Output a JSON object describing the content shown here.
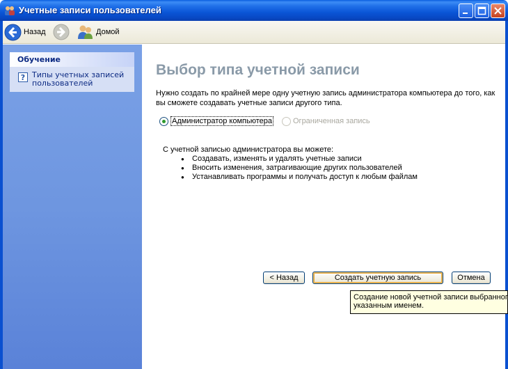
{
  "window": {
    "title": "Учетные записи пользователей"
  },
  "toolbar": {
    "back_label": "Назад",
    "home_label": "Домой"
  },
  "sidebar": {
    "header": "Обучение",
    "link": "Типы учетных записей пользователей"
  },
  "main": {
    "title": "Выбор типа учетной записи",
    "description": "Нужно создать по крайней мере одну учетную запись администратора компьютера до того, как вы сможете создавать учетные записи другого типа.",
    "radio_admin": "Администратор компьютера",
    "radio_limited": "Ограниченная запись",
    "info_heading": "С учетной записью администратора вы можете:",
    "bullets": [
      "Создавать, изменять и удалять учетные записи",
      "Вносить изменения, затрагивающие других пользователей",
      "Устанавливать программы и получать доступ к любым файлам"
    ]
  },
  "buttons": {
    "back": "< Назад",
    "create": "Создать учетную запись",
    "cancel": "Отмена"
  },
  "tooltip": {
    "line1": "Создание новой учетной записи выбранного",
    "line2": "указанным именем."
  },
  "colors": {
    "title_bar": "#0a55d6",
    "left_pane": "#7aa1e6",
    "main_title": "#8a9aa8"
  }
}
